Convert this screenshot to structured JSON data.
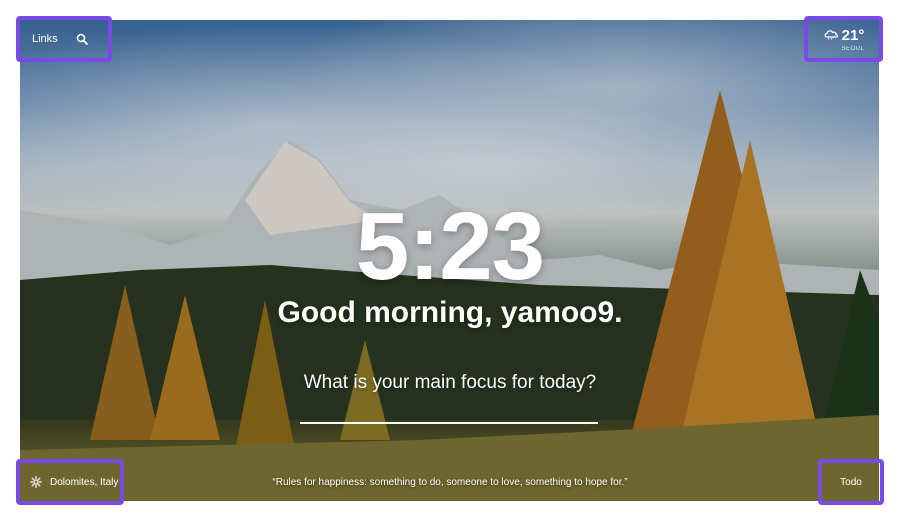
{
  "top_left": {
    "links_label": "Links",
    "search_icon": "search-icon"
  },
  "weather": {
    "icon": "cloud-icon",
    "temperature": "21°",
    "city": "SEOUL"
  },
  "center": {
    "time": "5:23",
    "greeting": "Good morning, yamoo9.",
    "focus_question": "What is your main focus for today?",
    "focus_value": ""
  },
  "bottom_left": {
    "settings_icon": "gear-icon",
    "location": "Dolomites, Italy"
  },
  "quote": "“Rules for happiness: something to do, someone to love, something to hope for.”",
  "bottom_right": {
    "todo_label": "Todo"
  },
  "colors": {
    "highlight_border": "#7a4ae6",
    "text": "#ffffff"
  }
}
